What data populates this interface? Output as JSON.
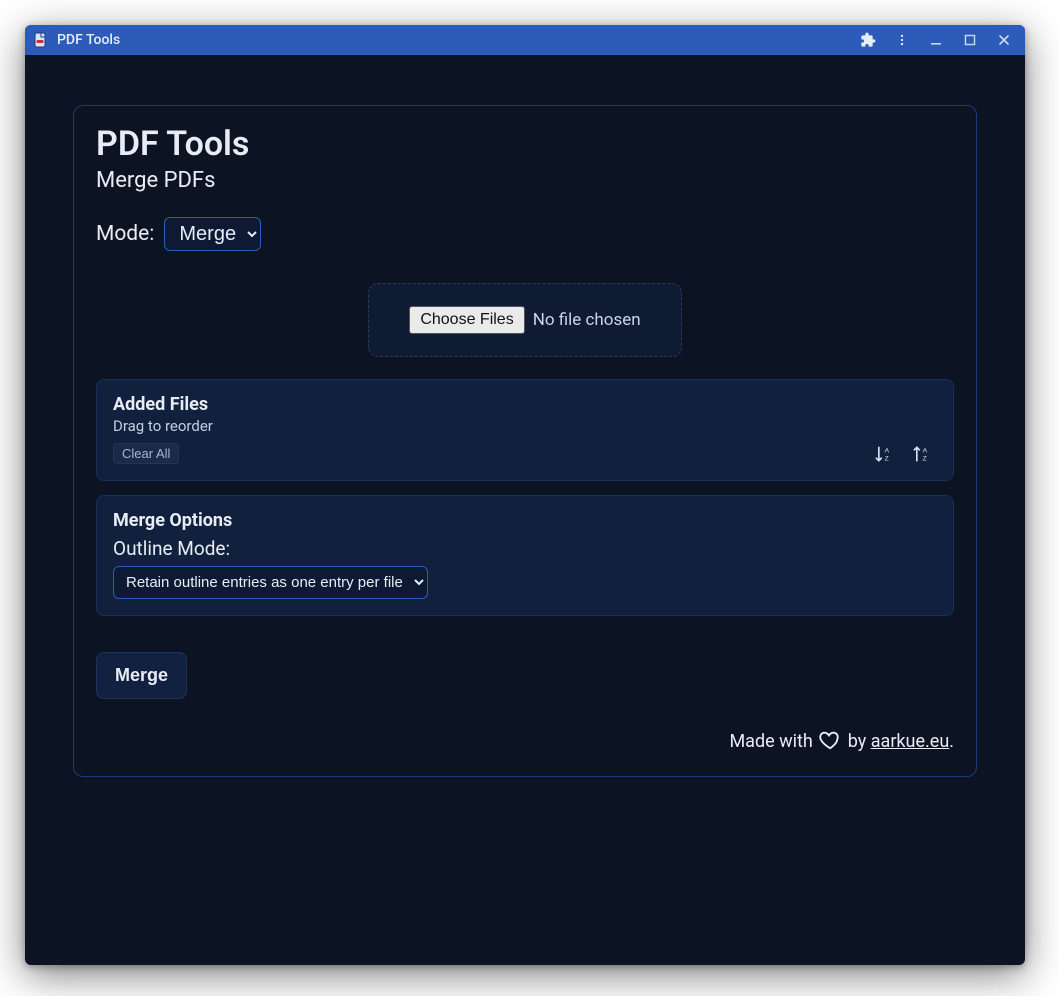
{
  "window": {
    "title": "PDF Tools"
  },
  "main": {
    "app_title": "PDF Tools",
    "subtitle": "Merge PDFs",
    "mode_label": "Mode:",
    "mode_selected": "Merge",
    "file_picker": {
      "button_label": "Choose Files",
      "status_text": "No file chosen"
    },
    "added_files": {
      "title": "Added Files",
      "hint": "Drag to reorder",
      "clear_label": "Clear All"
    },
    "merge_options": {
      "title": "Merge Options",
      "outline_label": "Outline Mode:",
      "outline_selected": "Retain outline entries as one entry per file"
    },
    "merge_button": "Merge",
    "footer": {
      "prefix": "Made with ",
      "by_text": " by ",
      "link_text": "aarkue.eu",
      "suffix": "."
    }
  }
}
